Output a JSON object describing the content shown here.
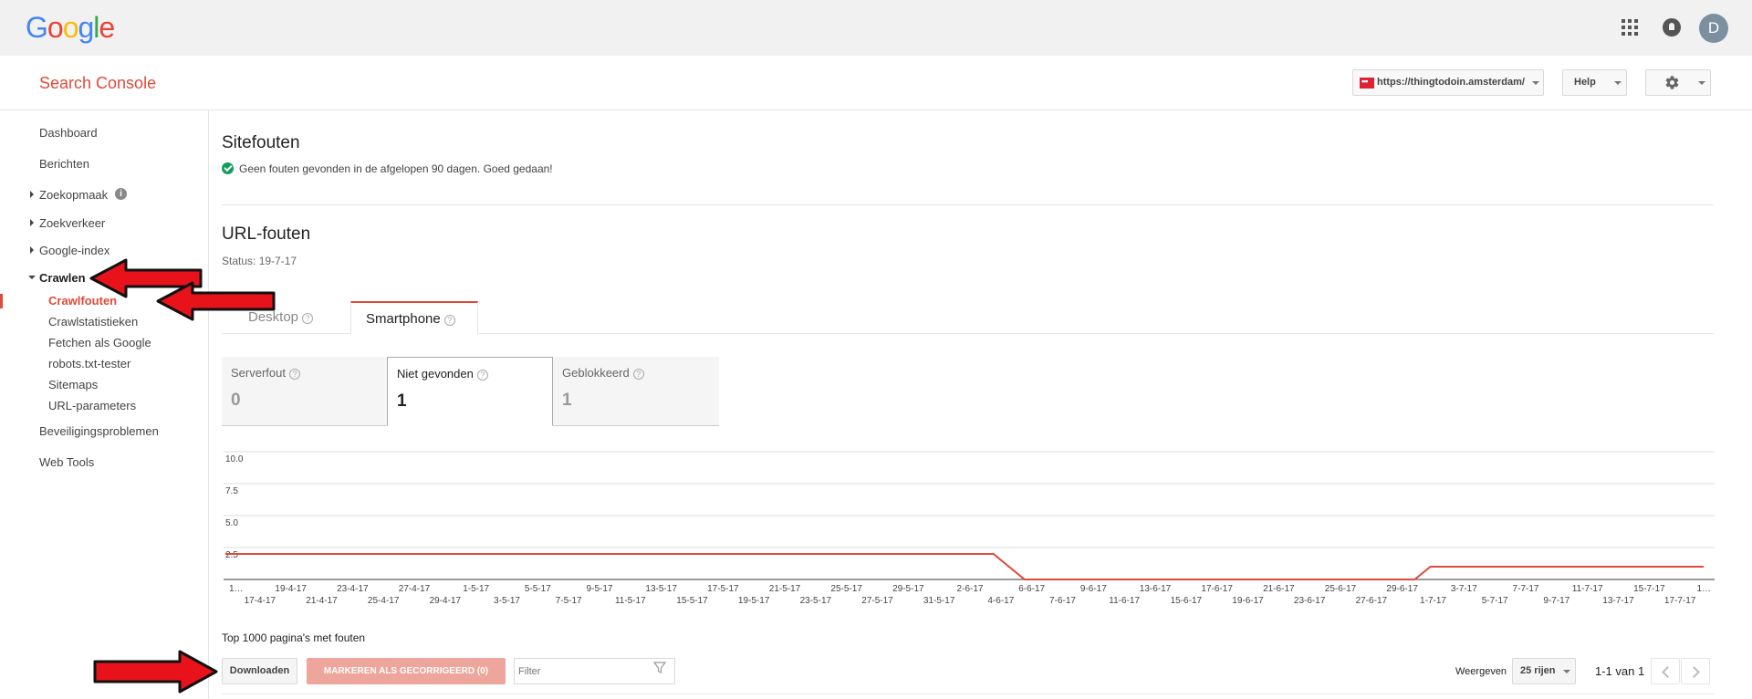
{
  "topbar": {
    "logo_letters": [
      {
        "ch": "G",
        "color": "#4285f4"
      },
      {
        "ch": "o",
        "color": "#ea4335"
      },
      {
        "ch": "o",
        "color": "#fbbc05"
      },
      {
        "ch": "g",
        "color": "#4285f4"
      },
      {
        "ch": "l",
        "color": "#34a853"
      },
      {
        "ch": "e",
        "color": "#ea4335"
      }
    ],
    "apps_icon": "apps-grid-icon",
    "notifications_icon": "bell-icon",
    "avatar_letter": "D"
  },
  "header": {
    "product_name": "Search Console",
    "site_url": "https://thingtodoin.amsterdam/",
    "help_label": "Help",
    "settings_icon": "gear-icon"
  },
  "sidebar": {
    "items": [
      {
        "label": "Dashboard"
      },
      {
        "label": "Berichten"
      },
      {
        "label": "Zoekopmaak"
      },
      {
        "label": "Zoekverkeer"
      },
      {
        "label": "Google-index"
      },
      {
        "label": "Crawlen"
      },
      {
        "label": "Beveiligingsproblemen"
      },
      {
        "label": "Web Tools"
      }
    ],
    "info_glyph": "i",
    "crawl_sub": [
      {
        "label": "Crawlfouten",
        "active": true
      },
      {
        "label": "Crawlstatistieken"
      },
      {
        "label": "Fetchen als Google"
      },
      {
        "label": "robots.txt-tester"
      },
      {
        "label": "Sitemaps"
      },
      {
        "label": "URL-parameters"
      }
    ]
  },
  "main": {
    "site_errors_title": "Sitefouten",
    "site_errors_message": "Geen fouten gevonden in de afgelopen 90 dagen. Goed gedaan!",
    "url_errors_title": "URL-fouten",
    "status": "Status: 19-7-17",
    "tabs": [
      {
        "label": "Desktop"
      },
      {
        "label": "Smartphone"
      }
    ],
    "help_glyph": "?",
    "metrics": [
      {
        "label": "Serverfout",
        "value": "0"
      },
      {
        "label": "Niet gevonden",
        "value": "1"
      },
      {
        "label": "Geblokkeerd",
        "value": "1"
      }
    ],
    "top_pages_title": "Top 1000 pagina's met fouten",
    "download_label": "Downloaden",
    "mark_fixed_label": "MARKEREN ALS GECORRIGEERD (0)",
    "filter_placeholder": "Filter",
    "show_label": "Weergeven",
    "rows_value": "25 rijen",
    "range_text": "1-1 van 1"
  },
  "chart_data": {
    "type": "line",
    "yticks": [
      "10.0",
      "7.5",
      "5.0",
      "2.5"
    ],
    "ylim": [
      0,
      10
    ],
    "series_color": "#dd4b39",
    "x": [
      "1…",
      "17-4-17",
      "19-4-17",
      "21-4-17",
      "23-4-17",
      "25-4-17",
      "27-4-17",
      "29-4-17",
      "1-5-17",
      "3-5-17",
      "5-5-17",
      "7-5-17",
      "9-5-17",
      "11-5-17",
      "13-5-17",
      "15-5-17",
      "17-5-17",
      "19-5-17",
      "21-5-17",
      "23-5-17",
      "25-5-17",
      "27-5-17",
      "29-5-17",
      "31-5-17",
      "2-6-17",
      "4-6-17",
      "6-6-17",
      "7-6-17",
      "9-6-17",
      "11-6-17",
      "13-6-17",
      "15-6-17",
      "17-6-17",
      "19-6-17",
      "21-6-17",
      "23-6-17",
      "25-6-17",
      "27-6-17",
      "29-6-17",
      "1-7-17",
      "3-7-17",
      "5-7-17",
      "7-7-17",
      "9-7-17",
      "11-7-17",
      "13-7-17",
      "15-7-17",
      "17-7-17",
      "1…"
    ],
    "points": [
      {
        "x": "1…",
        "y": 2
      },
      {
        "x": "3-6-17",
        "y": 2
      },
      {
        "x": "5-6-17",
        "y": 0
      },
      {
        "x": "30-6-17",
        "y": 0
      },
      {
        "x": "1-7-17",
        "y": 1
      },
      {
        "x": "1…",
        "y": 1
      }
    ]
  },
  "annotations": {
    "arrow_color": "#e8121b"
  }
}
